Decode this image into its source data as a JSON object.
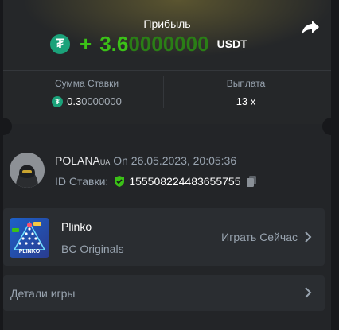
{
  "header": {
    "profit_label": "Прибыль",
    "plus_sign": "+",
    "amount_significant": "3.6",
    "amount_zeros": "0000000",
    "currency": "USDT"
  },
  "stats": {
    "bet_label": "Сумма Ставки",
    "bet_significant": "0.3",
    "bet_zeros": "0000000",
    "payout_label": "Выплата",
    "payout_value": "13 x"
  },
  "user": {
    "name": "POLANA",
    "name_suffix": "UA",
    "on_date": "On 26.05.2023, 20:05:36",
    "bet_id_label": "ID Ставки:",
    "bet_id_value": "155508224483655755"
  },
  "game": {
    "name": "Plinko",
    "provider": "BC Originals",
    "play_label": "Играть Сейчас",
    "thumb_label": "PLINKO"
  },
  "details": {
    "label": "Детали игры"
  },
  "colors": {
    "accent_green": "#3bc117",
    "tether": "#1ba27a",
    "background": "#17181b",
    "card": "#232528"
  },
  "icons": [
    "share-icon",
    "tether-icon",
    "shield-check-icon",
    "copy-icon",
    "chevron-right-icon"
  ]
}
